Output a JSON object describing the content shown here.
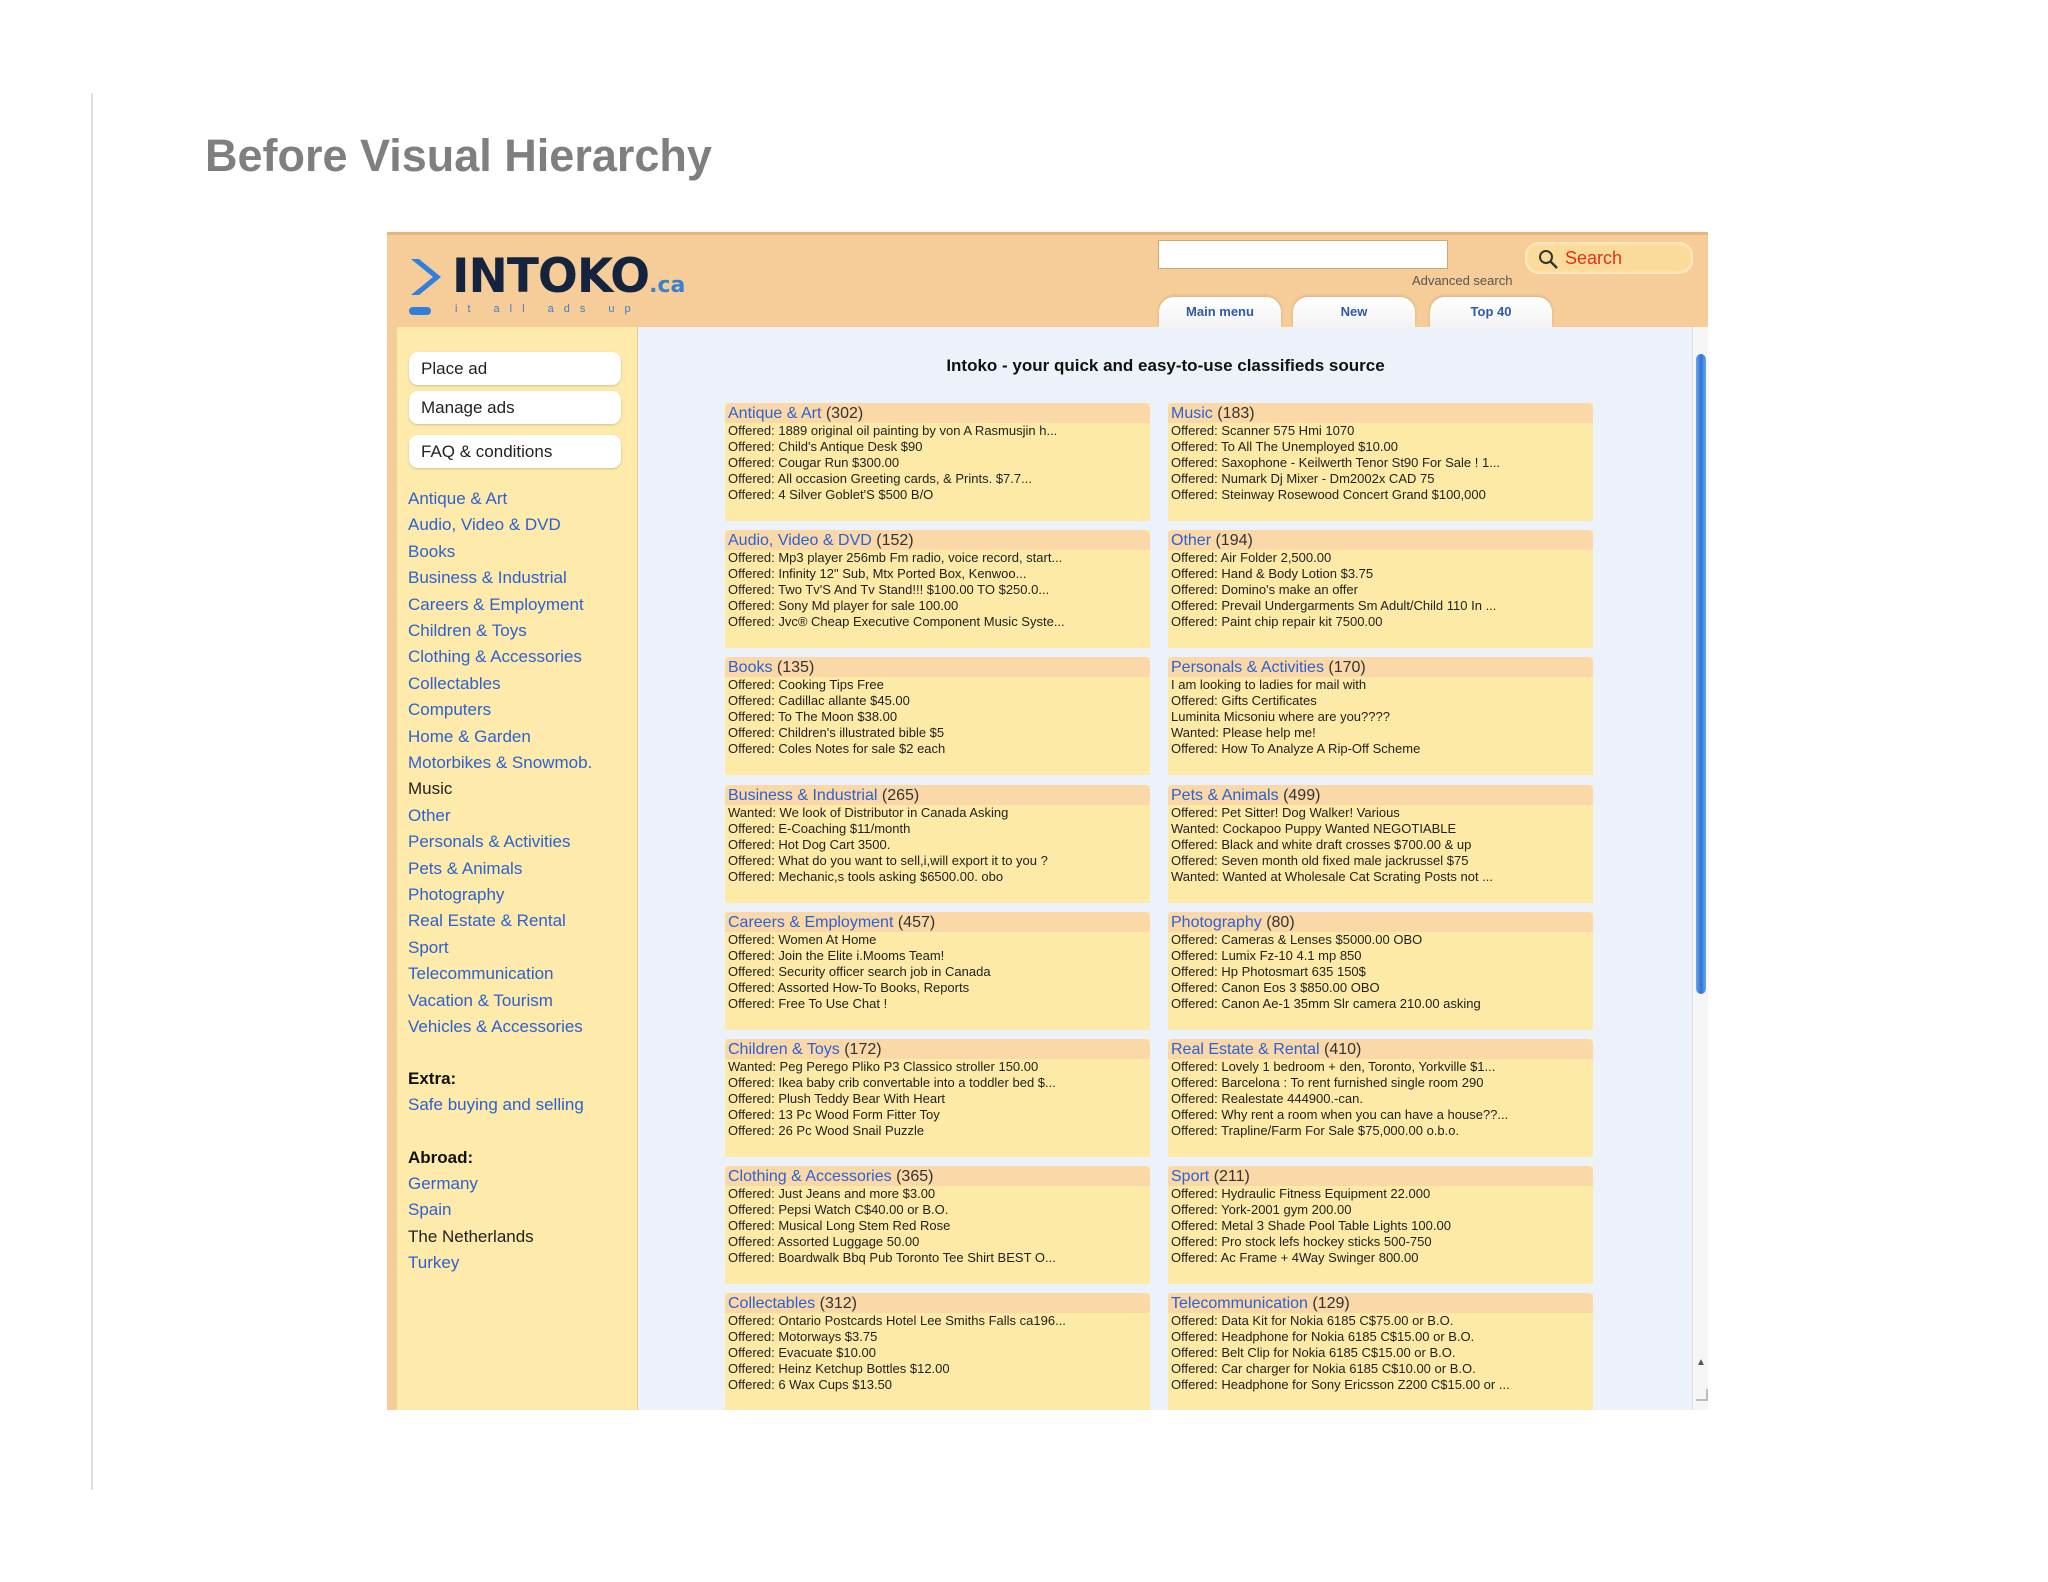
{
  "slide": {
    "title": "Before Visual Hierarchy"
  },
  "header": {
    "logo_text": "INTOKO",
    "logo_suffix": ".ca",
    "logo_tagline": "it all ads up",
    "search_placeholder": "",
    "search_label": "Search",
    "advanced_search": "Advanced search",
    "nav": [
      "Main menu",
      "New",
      "Top 40"
    ]
  },
  "sidebar": {
    "buttons": [
      "Place ad",
      "Manage ads",
      "FAQ & conditions"
    ],
    "categories": [
      "Antique & Art",
      "Audio, Video & DVD",
      "Books",
      "Business & Industrial",
      "Careers & Employment",
      "Children & Toys",
      "Clothing & Accessories",
      "Collectables",
      "Computers",
      "Home & Garden",
      "Motorbikes & Snowmob.",
      "Music",
      "Other",
      "Personals & Activities",
      "Pets & Animals",
      "Photography",
      "Real Estate & Rental",
      "Sport",
      "Telecommunication",
      "Vacation & Tourism",
      "Vehicles & Accessories"
    ],
    "extra_heading": "Extra:",
    "extra_links": [
      "Safe buying and selling"
    ],
    "abroad_heading": "Abroad:",
    "abroad_links": [
      "Germany",
      "Spain",
      "The Netherlands",
      "Turkey"
    ]
  },
  "main": {
    "title": "Intoko - your quick and easy-to-use classifieds source",
    "cards": [
      {
        "name": "Antique & Art",
        "count": "(302)",
        "ads": [
          "Offered: 1889 original oil painting by von A Rasmusjin h...",
          "Offered: Child's Antique Desk $90",
          "Offered: Cougar Run $300.00",
          "Offered: All occasion Greeting cards, & Prints. $7.7...",
          "Offered: 4 Silver Goblet'S $500 B/O"
        ]
      },
      {
        "name": "Music",
        "count": "(183)",
        "ads": [
          "Offered: Scanner 575 Hmi 1070",
          "Offered: To All The Unemployed $10.00",
          "Offered: Saxophone - Keilwerth Tenor St90 For Sale ! 1...",
          "Offered: Numark Dj Mixer - Dm2002x CAD 75",
          "Offered: Steinway Rosewood Concert Grand $100,000"
        ]
      },
      {
        "name": "Audio, Video & DVD",
        "count": "(152)",
        "ads": [
          "Offered: Mp3 player 256mb Fm radio, voice record, start...",
          "Offered: Infinity 12\" Sub, Mtx Ported Box, Kenwoo...",
          "Offered: Two Tv'S And Tv Stand!!! $100.00 TO $250.0...",
          "Offered: Sony Md player for sale 100.00",
          "Offered: Jvc® Cheap Executive Component Music Syste..."
        ]
      },
      {
        "name": "Other",
        "count": "(194)",
        "ads": [
          "Offered: Air Folder 2,500.00",
          "Offered: Hand & Body Lotion $3.75",
          "Offered: Domino's make an offer",
          "Offered: Prevail Undergarments Sm Adult/Child 110 In ...",
          "Offered: Paint chip repair kit 7500.00"
        ]
      },
      {
        "name": "Books",
        "count": "(135)",
        "ads": [
          "Offered: Cooking Tips Free",
          "Offered: Cadillac allante $45.00",
          "Offered: To The Moon $38.00",
          "Offered: Children's illustrated bible $5",
          "Offered: Coles Notes for sale $2 each"
        ]
      },
      {
        "name": "Personals & Activities",
        "count": "(170)",
        "ads": [
          "I am looking to ladies for mail with",
          "Offered: Gifts Certificates",
          "Luminita Micsoniu where are you????",
          "Wanted: Please help me!",
          "Offered: How To Analyze A Rip-Off Scheme"
        ]
      },
      {
        "name": "Business & Industrial",
        "count": "(265)",
        "ads": [
          "Wanted: We look of Distributor in Canada Asking",
          "Offered: E-Coaching $11/month",
          "Offered: Hot Dog Cart 3500.",
          "Offered: What do you want to sell,i,will export it to you ?",
          "Offered: Mechanic,s tools asking $6500.00. obo"
        ]
      },
      {
        "name": "Pets & Animals",
        "count": "(499)",
        "ads": [
          "Offered: Pet Sitter! Dog Walker! Various",
          "Wanted: Cockapoo Puppy Wanted NEGOTIABLE",
          "Offered: Black and white draft crosses $700.00 & up",
          "Offered: Seven month old fixed male jackrussel $75",
          "Wanted: Wanted at Wholesale Cat Scrating Posts not ..."
        ]
      },
      {
        "name": "Careers & Employment",
        "count": "(457)",
        "ads": [
          "Offered: Women At Home",
          "Offered: Join the Elite i.Mooms Team!",
          "Offered: Security officer search job in Canada",
          "Offered: Assorted How-To Books, Reports",
          "Offered: Free To Use Chat !"
        ]
      },
      {
        "name": "Photography",
        "count": "(80)",
        "ads": [
          "Offered: Cameras & Lenses $5000.00 OBO",
          "Offered: Lumix Fz-10 4.1 mp 850",
          "Offered: Hp Photosmart 635 150$",
          "Offered: Canon Eos 3 $850.00 OBO",
          "Offered: Canon Ae-1 35mm Slr camera 210.00 asking"
        ]
      },
      {
        "name": "Children & Toys",
        "count": "(172)",
        "ads": [
          "Wanted: Peg Perego Pliko P3 Classico stroller 150.00",
          "Offered: Ikea baby crib convertable into a toddler bed $...",
          "Offered: Plush Teddy Bear With Heart",
          "Offered: 13 Pc Wood Form Fitter Toy",
          "Offered: 26 Pc Wood Snail Puzzle"
        ]
      },
      {
        "name": "Real Estate & Rental",
        "count": "(410)",
        "ads": [
          "Offered: Lovely 1 bedroom + den, Toronto, Yorkville $1...",
          "Offered: Barcelona : To rent furnished single room 290",
          "Offered: Realestate 444900.-can.",
          "Offered: Why rent a room when you can have a house??...",
          "Offered: Trapline/Farm For Sale $75,000.00 o.b.o."
        ]
      },
      {
        "name": "Clothing & Accessories",
        "count": "(365)",
        "ads": [
          "Offered: Just Jeans and more $3.00",
          "Offered: Pepsi Watch C$40.00 or B.O.",
          "Offered: Musical Long Stem Red Rose",
          "Offered: Assorted Luggage 50.00",
          "Offered: Boardwalk Bbq Pub Toronto Tee Shirt BEST O..."
        ]
      },
      {
        "name": "Sport",
        "count": "(211)",
        "ads": [
          "Offered: Hydraulic Fitness Equipment 22.000",
          "Offered: York-2001 gym 200.00",
          "Offered: Metal 3 Shade Pool Table Lights 100.00",
          "Offered: Pro stock lefs hockey sticks 500-750",
          "Offered: Ac Frame + 4Way Swinger 800.00"
        ]
      },
      {
        "name": "Collectables",
        "count": "(312)",
        "ads": [
          "Offered: Ontario Postcards Hotel Lee Smiths Falls ca196...",
          "Offered: Motorways $3.75",
          "Offered: Evacuate $10.00",
          "Offered: Heinz Ketchup Bottles $12.00",
          "Offered: 6 Wax Cups $13.50"
        ]
      },
      {
        "name": "Telecommunication",
        "count": "(129)",
        "ads": [
          "Offered: Data Kit for Nokia 6185 C$75.00 or B.O.",
          "Offered: Headphone for Nokia 6185 C$15.00 or B.O.",
          "Offered: Belt Clip for Nokia 6185 C$15.00 or B.O.",
          "Offered: Car charger for Nokia 6185 C$10.00 or B.O.",
          "Offered: Headphone for Sony Ericsson Z200 C$15.00 or ..."
        ]
      }
    ]
  },
  "colors": {
    "header_bg": "#f6cd98",
    "sidebar_bg": "#feeaaa",
    "content_bg": "#edf1f9",
    "card_bg": "#fdeaa7",
    "link": "#2c62d2",
    "search_text": "#e0301e"
  }
}
